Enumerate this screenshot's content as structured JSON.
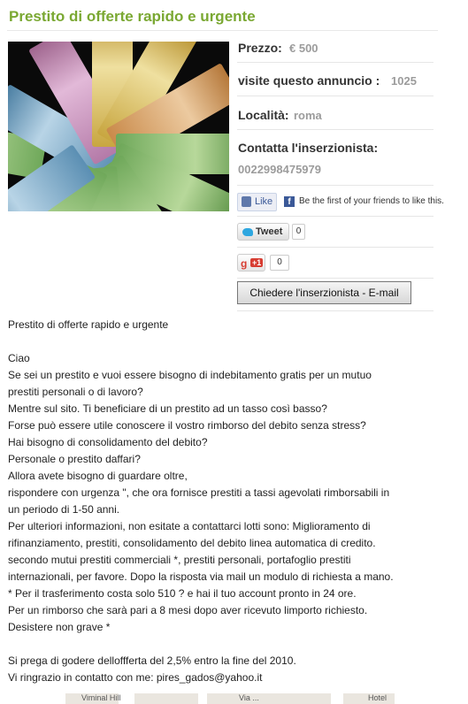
{
  "listing": {
    "title": "Prestito di offerte rapido e urgente",
    "image_alt": "euro-banknotes-fan"
  },
  "info": {
    "price_label": "Prezzo:",
    "price_value": "€ 500",
    "visits_label": "visite questo annuncio :",
    "visits_value": "1025",
    "location_label": "Località:",
    "location_value": "roma",
    "contact_label": "Contatta l'inserzionista:",
    "contact_phone": "0022998475979"
  },
  "social": {
    "fb_like_label": "Like",
    "fb_text": "Be the first of your friends to like this.",
    "tweet_label": "Tweet",
    "tweet_count": "0",
    "gplus_label": "+1",
    "gplus_count": "0"
  },
  "contact_button_label": "Chiedere l'inserzionista - E-mail",
  "description": {
    "lines": [
      "Prestito di offerte rapido e urgente",
      "",
      "Ciao",
      "Se sei un prestito e vuoi essere bisogno di indebitamento gratis per un mutuo",
      "prestiti personali o di lavoro?",
      "Mentre sul sito. Ti beneficiare di un prestito ad un tasso così basso?",
      "Forse può essere utile conoscere il vostro rimborso del debito senza stress?",
      "Hai bisogno di consolidamento del debito?",
      "Personale o prestito daffari?",
      "Allora avete bisogno di guardare oltre,",
      "rispondere con urgenza \", che ora fornisce prestiti a tassi agevolati rimborsabili in",
      "un periodo di 1-50 anni.",
      "Per ulteriori informazioni, non esitate a contattarci lotti sono: Miglioramento di",
      "rifinanziamento, prestiti, consolidamento del debito linea automatica di credito.",
      "secondo mutui prestiti commerciali *, prestiti personali, portafoglio prestiti",
      "internazionali, per favore. Dopo la risposta via mail un modulo di richiesta a mano.",
      "* Per il trasferimento costa solo 510 ? e hai il tuo account pronto in 24 ore.",
      "Per un rimborso che sarà pari a 8 mesi dopo aver ricevuto limporto richiesto.",
      "Desistere non grave *",
      "",
      "Si prega di godere delloffferta del 2,5% entro la fine del 2010.",
      "Vi ringrazio in contatto con me: pires_gados@yahoo.it"
    ]
  },
  "map": {
    "label_1": "Viminal Hill",
    "label_2": "Via ...",
    "label_3": "Hotel"
  },
  "colors": {
    "title_green": "#7aa832",
    "value_grey": "#9c9c9c",
    "facebook_blue": "#3b5998",
    "gplus_red": "#d73d32"
  }
}
